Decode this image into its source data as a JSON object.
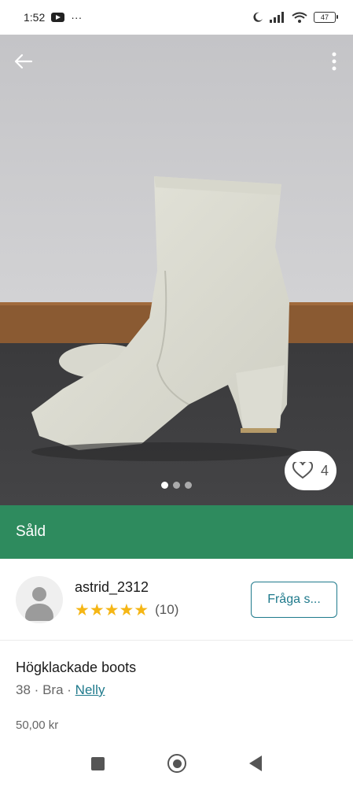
{
  "status_bar": {
    "time": "1:52",
    "more": "···",
    "battery": "47"
  },
  "photo": {
    "like_count": "4"
  },
  "banner": {
    "sold_label": "Såld"
  },
  "seller": {
    "name": "astrid_2312",
    "stars": "★★★★★",
    "rating_count": "(10)",
    "ask_button": "Fråga s..."
  },
  "item": {
    "title": "Högklackade boots",
    "size": "38",
    "condition": "Bra",
    "separator": "·",
    "brand": "Nelly",
    "price": "50,00 kr"
  },
  "colors": {
    "sold_green": "#2e8b5e",
    "accent_teal": "#1f7a8c",
    "star_gold": "#f5b615"
  }
}
